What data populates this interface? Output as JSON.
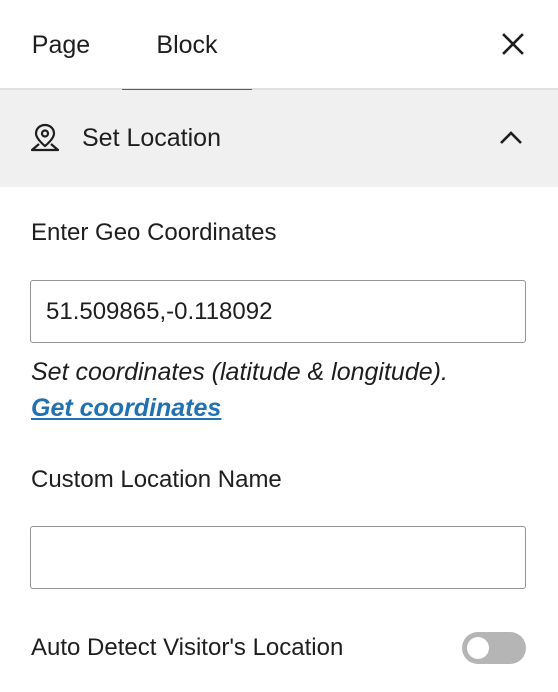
{
  "tabs": [
    {
      "label": "Page",
      "active": false
    },
    {
      "label": "Block",
      "active": true
    }
  ],
  "panel": {
    "title": "Set Location",
    "icon": "location-pin-icon",
    "expanded": true
  },
  "geo": {
    "label": "Enter Geo Coordinates",
    "value": "51.509865,-0.118092",
    "help": "Set coordinates (latitude & longitude).",
    "link": "Get coordinates"
  },
  "custom_location": {
    "label": "Custom Location Name",
    "value": ""
  },
  "auto_detect": {
    "label": "Auto Detect Visitor's Location",
    "enabled": false
  },
  "colors": {
    "accent": "#007cba",
    "link": "#2271b1",
    "header_bg": "#f0f0f0",
    "toggle_off": "#b5b5b5"
  }
}
